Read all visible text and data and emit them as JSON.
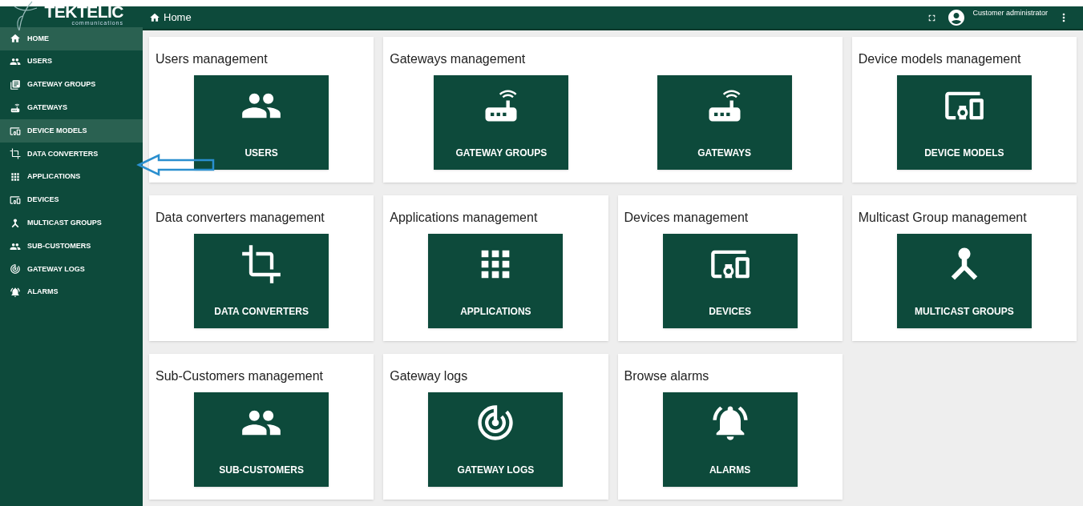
{
  "logo": {
    "name": "TEKTELIC",
    "tagline": "communications"
  },
  "header": {
    "title": "Home",
    "user_role": "Customer administrator"
  },
  "sidebar": {
    "items": [
      {
        "label": "HOME",
        "kind": "home",
        "selected": true
      },
      {
        "label": "USERS",
        "kind": "users",
        "selected": false
      },
      {
        "label": "GATEWAY GROUPS",
        "kind": "groups",
        "selected": false
      },
      {
        "label": "GATEWAYS",
        "kind": "gateway",
        "selected": false
      },
      {
        "label": "DEVICE MODELS",
        "kind": "device",
        "selected": true
      },
      {
        "label": "DATA CONVERTERS",
        "kind": "converter",
        "selected": false
      },
      {
        "label": "APPLICATIONS",
        "kind": "apps",
        "selected": false
      },
      {
        "label": "DEVICES",
        "kind": "device",
        "selected": false
      },
      {
        "label": "MULTICAST GROUPS",
        "kind": "multicast",
        "selected": false
      },
      {
        "label": "SUB-CUSTOMERS",
        "kind": "users",
        "selected": false
      },
      {
        "label": "GATEWAY LOGS",
        "kind": "logs",
        "selected": false
      },
      {
        "label": "ALARMS",
        "kind": "alarm",
        "selected": false
      }
    ]
  },
  "sections": [
    {
      "title": "Users management",
      "tiles": [
        {
          "label": "USERS",
          "kind": "users"
        }
      ]
    },
    {
      "title": "Gateways management",
      "tiles": [
        {
          "label": "GATEWAY GROUPS",
          "kind": "gateway"
        },
        {
          "label": "GATEWAYS",
          "kind": "gateway"
        }
      ]
    },
    {
      "title": "Device models management",
      "tiles": [
        {
          "label": "DEVICE MODELS",
          "kind": "device"
        }
      ]
    },
    {
      "title": "Data converters management",
      "tiles": [
        {
          "label": "DATA CONVERTERS",
          "kind": "converter"
        }
      ]
    },
    {
      "title": "Applications management",
      "tiles": [
        {
          "label": "APPLICATIONS",
          "kind": "apps"
        }
      ]
    },
    {
      "title": "Devices management",
      "tiles": [
        {
          "label": "DEVICES",
          "kind": "device"
        }
      ]
    },
    {
      "title": "Multicast Group management",
      "tiles": [
        {
          "label": "MULTICAST GROUPS",
          "kind": "multicast"
        }
      ]
    },
    {
      "title": "Sub-Customers management",
      "tiles": [
        {
          "label": "SUB-CUSTOMERS",
          "kind": "users"
        }
      ]
    },
    {
      "title": "Gateway logs",
      "tiles": [
        {
          "label": "GATEWAY LOGS",
          "kind": "logs"
        }
      ]
    },
    {
      "title": "Browse alarms",
      "tiles": [
        {
          "label": "ALARMS",
          "kind": "alarm"
        }
      ]
    }
  ]
}
